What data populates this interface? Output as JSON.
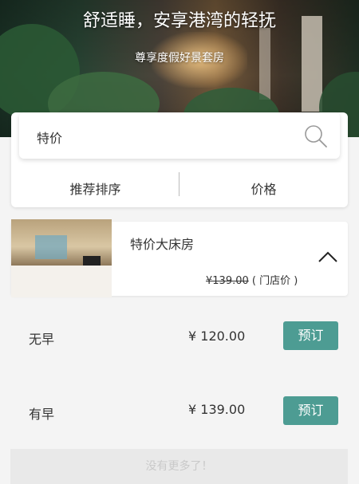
{
  "hero": {
    "title": "舒适睡，安享港湾的轻抚",
    "subtitle": "尊享度假好景套房"
  },
  "search": {
    "query": "特价",
    "icon": "search-icon"
  },
  "sort": {
    "recommended_label": "推荐排序",
    "price_label": "价格"
  },
  "room": {
    "name": "特价大床房",
    "store_price": "¥139.00",
    "store_price_note": "( 门店价 )",
    "expand_icon": "chevron-up-icon"
  },
  "rates": [
    {
      "label": "无早",
      "price": "¥ 120.00",
      "button": "预订"
    },
    {
      "label": "有早",
      "price": "¥ 139.00",
      "button": "预订"
    }
  ],
  "footer": {
    "no_more": "没有更多了！"
  },
  "colors": {
    "accent": "#4d9c93",
    "background": "#f4f4f4"
  }
}
